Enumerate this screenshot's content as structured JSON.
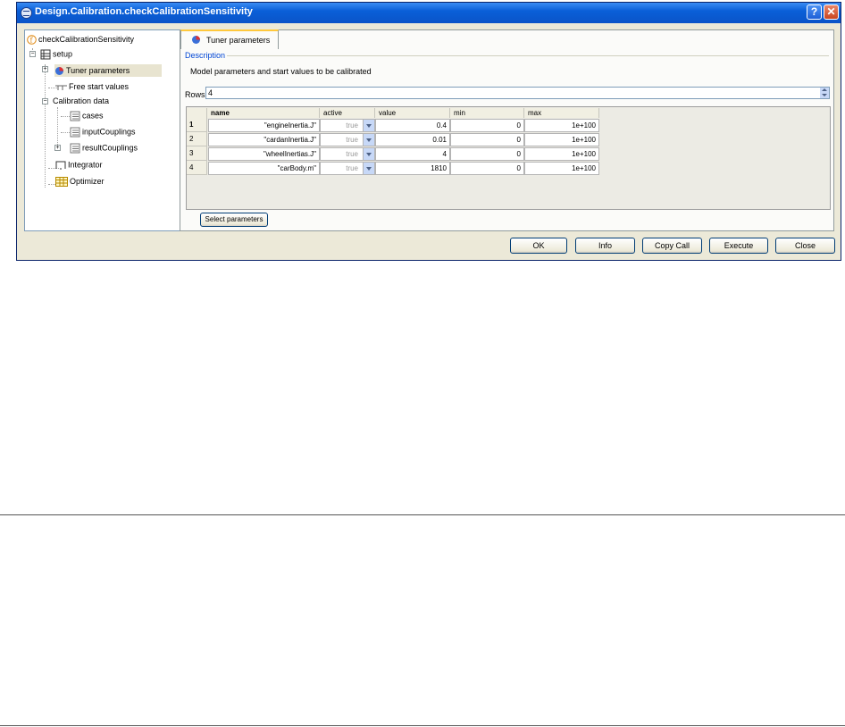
{
  "window": {
    "title": "Design.Calibration.checkCalibrationSensitivity"
  },
  "tree": {
    "root": "checkCalibrationSensitivity",
    "setup": "setup",
    "tuner": "Tuner parameters",
    "free": "Free start values",
    "calib": "Calibration data",
    "cases": "cases",
    "inputCouplings": "inputCouplings",
    "resultCouplings": "resultCouplings",
    "integrator": "Integrator",
    "optimizer": "Optimizer"
  },
  "tab": {
    "label": "Tuner parameters"
  },
  "description": {
    "legend": "Description",
    "text": "Model parameters and start values to be calibrated"
  },
  "rows": {
    "label": "Rows",
    "value": "4"
  },
  "table": {
    "columns": [
      "name",
      "active",
      "value",
      "min",
      "max"
    ],
    "rows": [
      {
        "num": "1",
        "name": "\"engineInertia.J\"",
        "active": "true",
        "value": "0.4",
        "min": "0",
        "max": "1e+100"
      },
      {
        "num": "2",
        "name": "\"cardanInertia.J\"",
        "active": "true",
        "value": "0.01",
        "min": "0",
        "max": "1e+100"
      },
      {
        "num": "3",
        "name": "\"wheelInertias.J\"",
        "active": "true",
        "value": "4",
        "min": "0",
        "max": "1e+100"
      },
      {
        "num": "4",
        "name": "\"carBody.m\"",
        "active": "true",
        "value": "1810",
        "min": "0",
        "max": "1e+100"
      }
    ]
  },
  "select_button": "Select parameters",
  "buttons": {
    "ok": "OK",
    "info": "Info",
    "copy": "Copy Call",
    "execute": "Execute",
    "close": "Close"
  },
  "colors": {
    "titlebar": "#0b54c8",
    "tab_highlight": "#ffc83c",
    "legend": "#0046d5"
  },
  "icons": [
    "window-icon",
    "function-icon",
    "table-icon",
    "pie-icon",
    "list-icon",
    "integrator-icon",
    "grid-icon",
    "help-icon",
    "close-icon"
  ]
}
